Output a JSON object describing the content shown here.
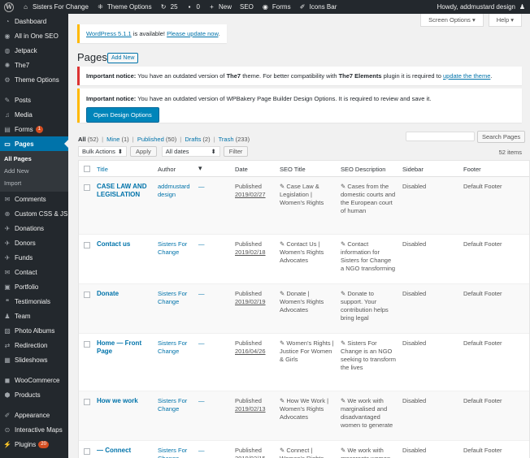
{
  "adminbar": {
    "site_name": "Sisters For Change",
    "theme_options": "Theme Options",
    "updates_count": "25",
    "comments_count": "0",
    "new_label": "New",
    "seo_label": "SEO",
    "forms_label": "Forms",
    "icons_bar_label": "Icons Bar",
    "howdy": "Howdy, addmustard design"
  },
  "sidebar": {
    "items": [
      {
        "label": "Dashboard",
        "icon": "dashboard-icon",
        "glyph": "◔"
      },
      {
        "label": "All in One SEO",
        "icon": "seo-icon",
        "glyph": "◉"
      },
      {
        "label": "Jetpack",
        "icon": "jetpack-icon",
        "glyph": "◍"
      },
      {
        "label": "The7",
        "icon": "the7-icon",
        "glyph": "✺"
      },
      {
        "label": "Theme Options",
        "icon": "theme-options-icon",
        "glyph": "⚙"
      },
      {
        "label": "Posts",
        "icon": "pin-icon",
        "glyph": "✎"
      },
      {
        "label": "Media",
        "icon": "media-icon",
        "glyph": "♫"
      },
      {
        "label": "Forms",
        "icon": "forms-icon",
        "glyph": "▤",
        "badge": "1"
      },
      {
        "label": "Pages",
        "icon": "pages-icon",
        "glyph": "▭"
      },
      {
        "label": "Comments",
        "icon": "comments-icon",
        "glyph": "✉"
      },
      {
        "label": "Custom CSS & JS",
        "icon": "custom-css-icon",
        "glyph": "⊕"
      },
      {
        "label": "Donations",
        "icon": "donations-icon",
        "glyph": "✈"
      },
      {
        "label": "Donors",
        "icon": "donors-icon",
        "glyph": "✈"
      },
      {
        "label": "Funds",
        "icon": "funds-icon",
        "glyph": "✈"
      },
      {
        "label": "Contact",
        "icon": "contact-icon",
        "glyph": "✉"
      },
      {
        "label": "Portfolio",
        "icon": "portfolio-icon",
        "glyph": "▣"
      },
      {
        "label": "Testimonials",
        "icon": "testimonials-icon",
        "glyph": "❝"
      },
      {
        "label": "Team",
        "icon": "team-icon",
        "glyph": "♟"
      },
      {
        "label": "Photo Albums",
        "icon": "photo-albums-icon",
        "glyph": "▨"
      },
      {
        "label": "Redirection",
        "icon": "redirection-icon",
        "glyph": "⇄"
      },
      {
        "label": "Slideshows",
        "icon": "slideshows-icon",
        "glyph": "▦"
      },
      {
        "label": "WooCommerce",
        "icon": "woocommerce-icon",
        "glyph": "◼"
      },
      {
        "label": "Products",
        "icon": "products-icon",
        "glyph": "⬢"
      },
      {
        "label": "Appearance",
        "icon": "appearance-icon",
        "glyph": "✐"
      },
      {
        "label": "Interactive Maps",
        "icon": "maps-icon",
        "glyph": "⊙"
      },
      {
        "label": "Plugins",
        "icon": "plugins-icon",
        "glyph": "⚡",
        "badge": "20"
      }
    ],
    "submenu": [
      "All Pages",
      "Add New",
      "Import"
    ]
  },
  "screen_options": "Screen Options ▾",
  "help": "Help ▾",
  "notice_update": {
    "link1": "WordPress 5.1.1",
    "text": " is available! ",
    "link2": "Please update now",
    "end": "."
  },
  "page_title": "Pages",
  "add_new": "Add New",
  "notice_the7": {
    "strong1": "Important notice:",
    "text1": " You have an outdated version of ",
    "strong2": "The7",
    "text2": " theme. For better compatibility with ",
    "strong3": "The7 Elements",
    "text3": " plugin it is required to ",
    "link": "update the theme",
    "end": "."
  },
  "notice_wpbakery": {
    "strong1": "Important notice:",
    "text1": " You have an outdated version of WPBakery Page Builder Design Options. It is required to review and save it.",
    "button": "Open Design Options"
  },
  "filters": {
    "all": "All",
    "all_count": " (52)",
    "mine": "Mine",
    "mine_count": " (1)",
    "published": "Published",
    "published_count": " (50)",
    "drafts": "Drafts",
    "drafts_count": " (2)",
    "trash": "Trash",
    "trash_count": " (233)",
    "pipe": "|"
  },
  "search_button": "Search Pages",
  "bulk_actions": "Bulk Actions",
  "apply": "Apply",
  "all_dates": "All dates",
  "filter": "Filter",
  "items_count": "52 items",
  "columns": {
    "title": "Title",
    "author": "Author",
    "date": "Date",
    "seo_title": "SEO Title",
    "seo_description": "SEO Description",
    "sidebar": "Sidebar",
    "footer": "Footer"
  },
  "rows": [
    {
      "title": "CASE LAW AND LEGISLATION",
      "author": "addmustard design",
      "comments": "—",
      "status": "Published",
      "date": "2019/02/27",
      "seo_title": "✎ Case Law & Legislation | Women's Rights",
      "seo_desc": "✎ Cases from the domestic courts and the European court of human",
      "sidebar": "Disabled",
      "footer": "Default Footer"
    },
    {
      "title": "Contact us",
      "author": "Sisters For Change",
      "comments": "—",
      "status": "Published",
      "date": "2019/02/18",
      "seo_title": "✎ Contact Us | Women's Rights Advocates",
      "seo_desc": "✎ Contact information for Sisters for Change a NGO transforming",
      "sidebar": "Disabled",
      "footer": "Default Footer"
    },
    {
      "title": "Donate",
      "author": "Sisters For Change",
      "comments": "—",
      "status": "Published",
      "date": "2019/02/19",
      "seo_title": "✎ Donate | Women's Rights Advocates",
      "seo_desc": "✎ Donate to support. Your contribution helps bring legal",
      "sidebar": "Disabled",
      "footer": "Default Footer"
    },
    {
      "title": "Home — Front Page",
      "author": "Sisters For Change",
      "comments": "—",
      "status": "Published",
      "date": "2016/04/26",
      "seo_title": "✎ Women's Rights | Justice For Women & Girls",
      "seo_desc": "✎ Sisters For Change is an NGO seeking to transform the lives",
      "sidebar": "Disabled",
      "footer": "Default Footer"
    },
    {
      "title": "How we work",
      "author": "Sisters For Change",
      "comments": "—",
      "status": "Published",
      "date": "2019/02/13",
      "seo_title": "✎ How We Work | Women's Rights Advocates",
      "seo_desc": "✎ We work with marginalised and disadvantaged women to generate",
      "sidebar": "Disabled",
      "footer": "Default Footer"
    },
    {
      "title": "— Connect",
      "author": "Sisters For Change",
      "comments": "—",
      "status": "Published",
      "date": "2019/02/15",
      "seo_title": "✎ Connect | Women's Rights",
      "seo_desc": "✎ We work with grassroots women",
      "sidebar": "Disabled",
      "footer": "Default Footer"
    }
  ],
  "colors": {
    "accent": "#0073aa",
    "adminbar": "#23282d",
    "notice_red": "#dc3232",
    "notice_yellow": "#ffb900"
  }
}
